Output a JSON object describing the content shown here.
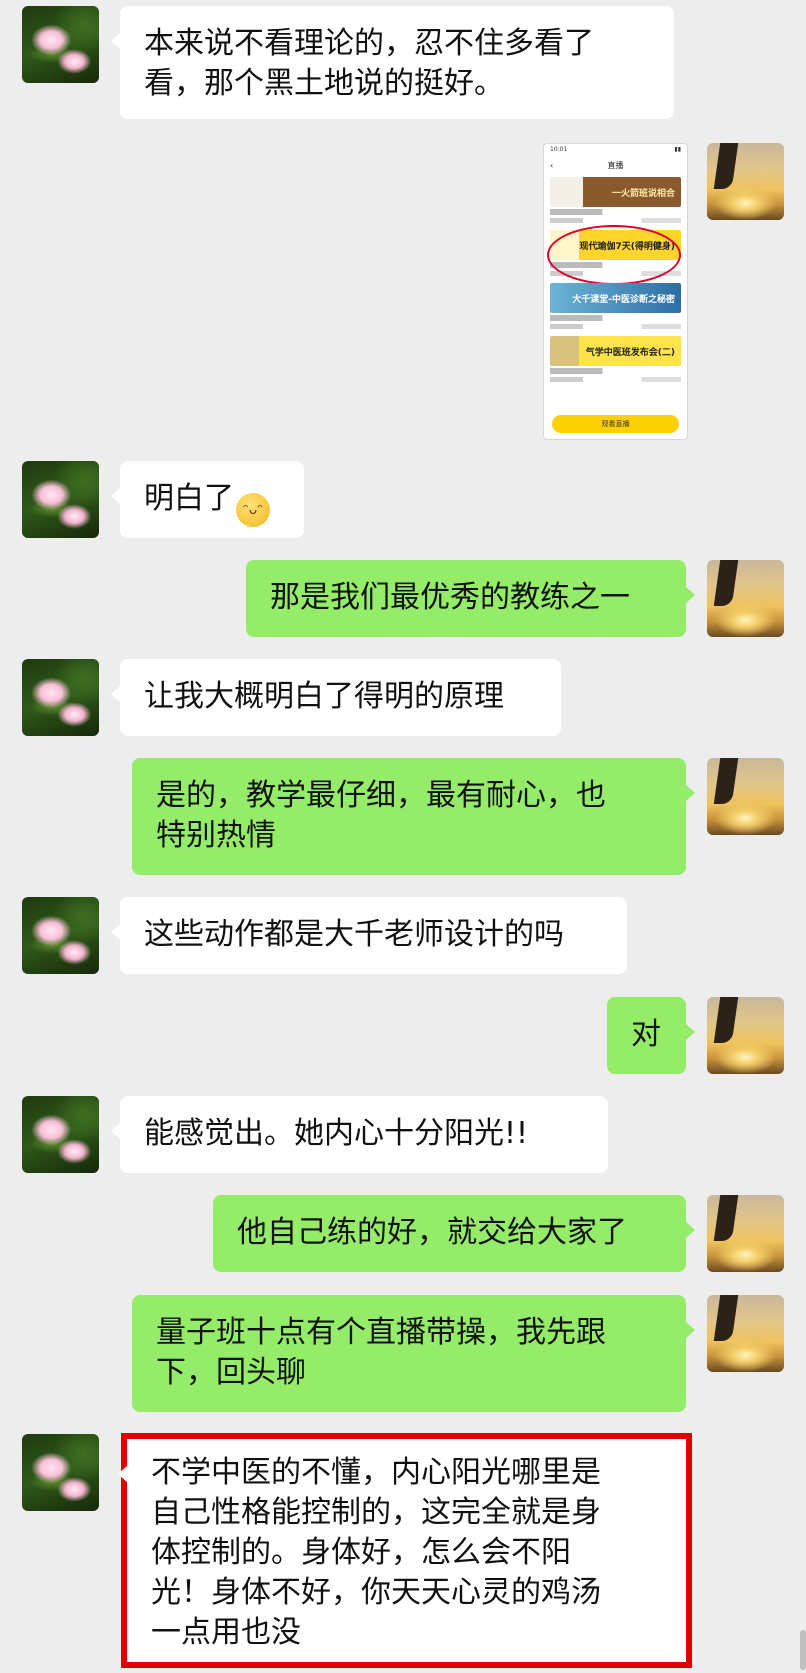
{
  "messages": [
    {
      "side": "left",
      "text": "本来说不看理论的，忍不住多看了\n看，那个黑土地说的挺好。"
    },
    {
      "side": "right",
      "type": "image",
      "thumb": {
        "status_time": "10:01",
        "title": "直播",
        "cards": [
          "一火箭班说相合",
          "现代瑜伽7天(得明健身)",
          "大千课堂-中医诊断之秘密",
          "气学中医班发布会(二)"
        ],
        "button": "观看直播"
      }
    },
    {
      "side": "left",
      "text": "明白了",
      "emoji": "grin"
    },
    {
      "side": "right",
      "text": "那是我们最优秀的教练之一"
    },
    {
      "side": "left",
      "text": "让我大概明白了得明的原理"
    },
    {
      "side": "right",
      "text": "是的，教学最仔细，最有耐心，也\n特别热情"
    },
    {
      "side": "left",
      "text": "这些动作都是大千老师设计的吗"
    },
    {
      "side": "right",
      "text": "对"
    },
    {
      "side": "left",
      "text": "能感觉出。她内心十分阳光!!"
    },
    {
      "side": "right",
      "text": "他自己练的好，就交给大家了"
    },
    {
      "side": "right",
      "text": "量子班十点有个直播带操，我先跟\n下，回头聊"
    },
    {
      "side": "left",
      "text": "不学中医的不懂，内心阳光哪里是\n自己性格能控制的，这完全就是身\n体控制的。身体好，怎么会不阳\n光！身体不好，你天天心灵的鸡汤\n一点用也没",
      "highlighted": true
    }
  ],
  "colors": {
    "background": "#ededed",
    "incoming": "#ffffff",
    "outgoing": "#95ec69",
    "highlight_border": "#e00000"
  },
  "icons": {
    "left_avatar": "lotus-avatar",
    "right_avatar": "sunset-climber-avatar",
    "emoji": "grinning-face-emoji"
  }
}
